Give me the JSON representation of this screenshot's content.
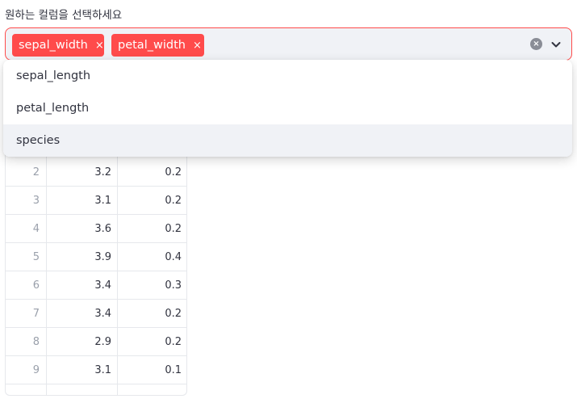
{
  "label": "원하는 컬럼을 선택하세요",
  "selected": [
    {
      "text": "sepal_width",
      "remove": "×"
    },
    {
      "text": "petal_width",
      "remove": "×"
    }
  ],
  "clear_symbol": "×",
  "options": [
    "sepal_length",
    "petal_length",
    "species"
  ],
  "rows": [
    {
      "idx": "2",
      "a": "3.2",
      "b": "0.2"
    },
    {
      "idx": "3",
      "a": "3.1",
      "b": "0.2"
    },
    {
      "idx": "4",
      "a": "3.6",
      "b": "0.2"
    },
    {
      "idx": "5",
      "a": "3.9",
      "b": "0.4"
    },
    {
      "idx": "6",
      "a": "3.4",
      "b": "0.3"
    },
    {
      "idx": "7",
      "a": "3.4",
      "b": "0.2"
    },
    {
      "idx": "8",
      "a": "2.9",
      "b": "0.2"
    },
    {
      "idx": "9",
      "a": "3.1",
      "b": "0.1"
    }
  ],
  "colors": {
    "accent": "#ff4b4b",
    "input_bg": "#f0f2f6"
  }
}
